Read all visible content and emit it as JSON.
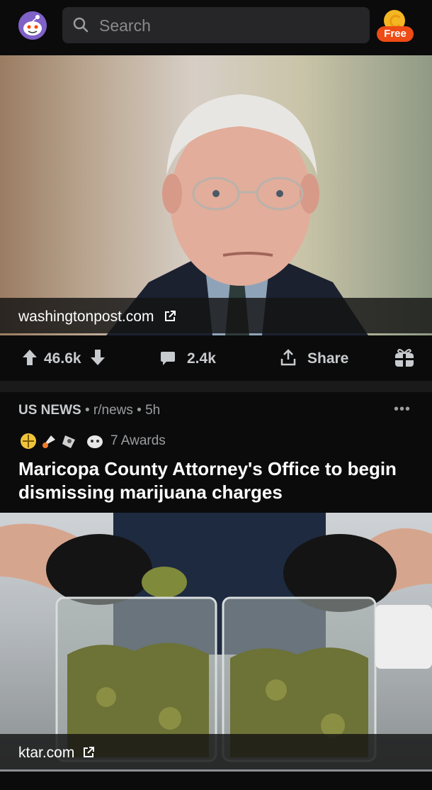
{
  "header": {
    "search_placeholder": "Search",
    "coins_badge": "Free"
  },
  "post1": {
    "link_domain": "washingtonpost.com",
    "upvotes": "46.6k",
    "comments": "2.4k",
    "share_label": "Share"
  },
  "post2": {
    "subreddit_tag": "US NEWS",
    "subreddit": "r/news",
    "age": "5h",
    "awards_count": "7 Awards",
    "title": "Maricopa County Attorney's Office to begin dismissing marijuana charges",
    "link_domain": "ktar.com"
  },
  "colors": {
    "accent_orange": "#ee4b15",
    "background": "#0b0b0b",
    "text_primary": "#ffffff"
  }
}
